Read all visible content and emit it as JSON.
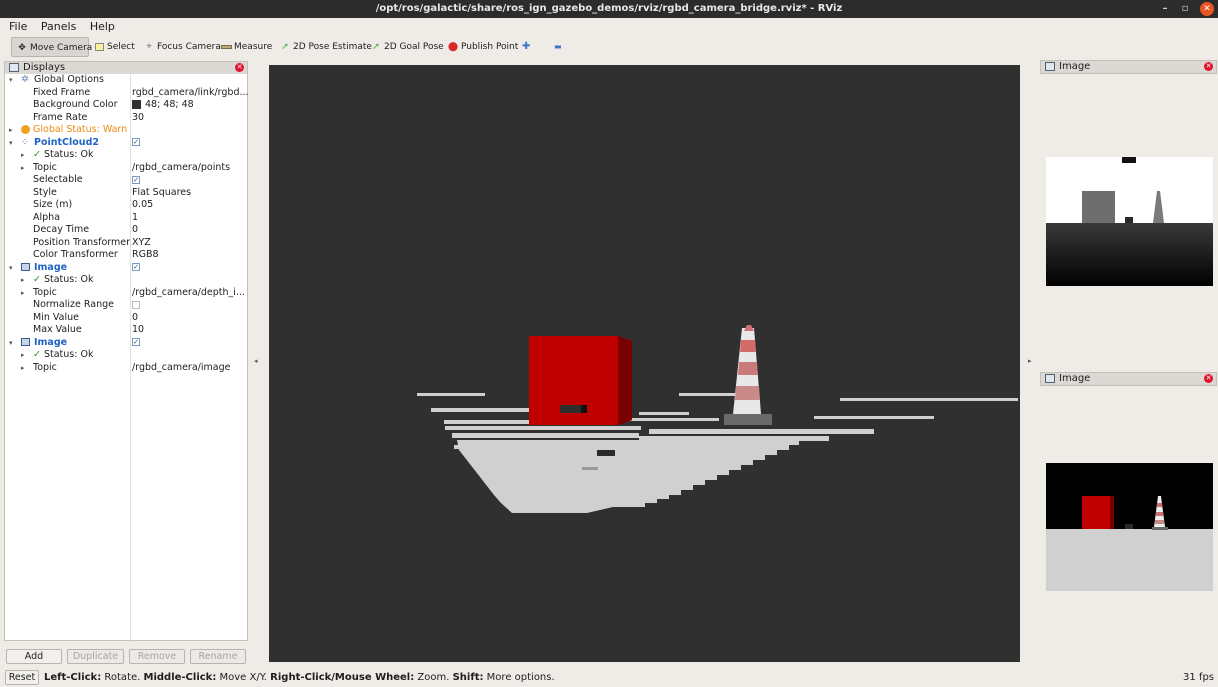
{
  "window": {
    "title": "/opt/ros/galactic/share/ros_ign_gazebo_demos/rviz/rgbd_camera_bridge.rviz* - RViz",
    "minimize_glyph": "–",
    "maximize_glyph": "▫",
    "close_glyph": "✕"
  },
  "menubar": {
    "file": "File",
    "panels": "Panels",
    "help": "Help"
  },
  "toolbar": {
    "move_camera": "Move Camera",
    "select": "Select",
    "focus_camera": "Focus Camera",
    "measure": "Measure",
    "pose_estimate": "2D Pose Estimate",
    "goal_pose": "2D Goal Pose",
    "publish_point": "Publish Point",
    "add_glyph": "✚",
    "remove_glyph": "▬"
  },
  "displays": {
    "title": "Displays",
    "global_options": {
      "label": "Global Options",
      "fixed_frame_label": "Fixed Frame",
      "fixed_frame_value": "rgbd_camera/link/rgbd...",
      "background_color_label": "Background Color",
      "background_color_value": "48; 48; 48",
      "background_color_hex": "#303030",
      "frame_rate_label": "Frame Rate",
      "frame_rate_value": "30"
    },
    "global_status": "Global Status: Warn",
    "pointcloud": {
      "label": "PointCloud2",
      "status": "Status: Ok",
      "topic_label": "Topic",
      "topic_value": "/rgbd_camera/points",
      "selectable_label": "Selectable",
      "style_label": "Style",
      "style_value": "Flat Squares",
      "size_label": "Size (m)",
      "size_value": "0.05",
      "alpha_label": "Alpha",
      "alpha_value": "1",
      "decay_label": "Decay Time",
      "decay_value": "0",
      "pos_tf_label": "Position Transformer",
      "pos_tf_value": "XYZ",
      "color_tf_label": "Color Transformer",
      "color_tf_value": "RGB8"
    },
    "image1": {
      "label": "Image",
      "status": "Status: Ok",
      "topic_label": "Topic",
      "topic_value": "/rgbd_camera/depth_i...",
      "normalize_label": "Normalize Range",
      "min_label": "Min Value",
      "min_value": "0",
      "max_label": "Max Value",
      "max_value": "10"
    },
    "image2": {
      "label": "Image",
      "status": "Status: Ok",
      "topic_label": "Topic",
      "topic_value": "/rgbd_camera/image"
    },
    "buttons": {
      "add": "Add",
      "duplicate": "Duplicate",
      "remove": "Remove",
      "rename": "Rename"
    }
  },
  "image_panel_1": {
    "title": "Image"
  },
  "image_panel_2": {
    "title": "Image"
  },
  "status_bar": {
    "reset": "Reset",
    "left_click": "Left-Click:",
    "left_click_desc": " Rotate. ",
    "middle_click": "Middle-Click:",
    "middle_click_desc": " Move X/Y. ",
    "right_click": "Right-Click/Mouse Wheel:",
    "right_click_desc": " Zoom. ",
    "shift": "Shift:",
    "shift_desc": " More options.",
    "fps": "31 fps"
  },
  "colors": {
    "viewport_bg": "#303030",
    "cube_red": "#c00000",
    "accent_blue": "#1f63c4",
    "warn_orange": "#e98a12"
  }
}
